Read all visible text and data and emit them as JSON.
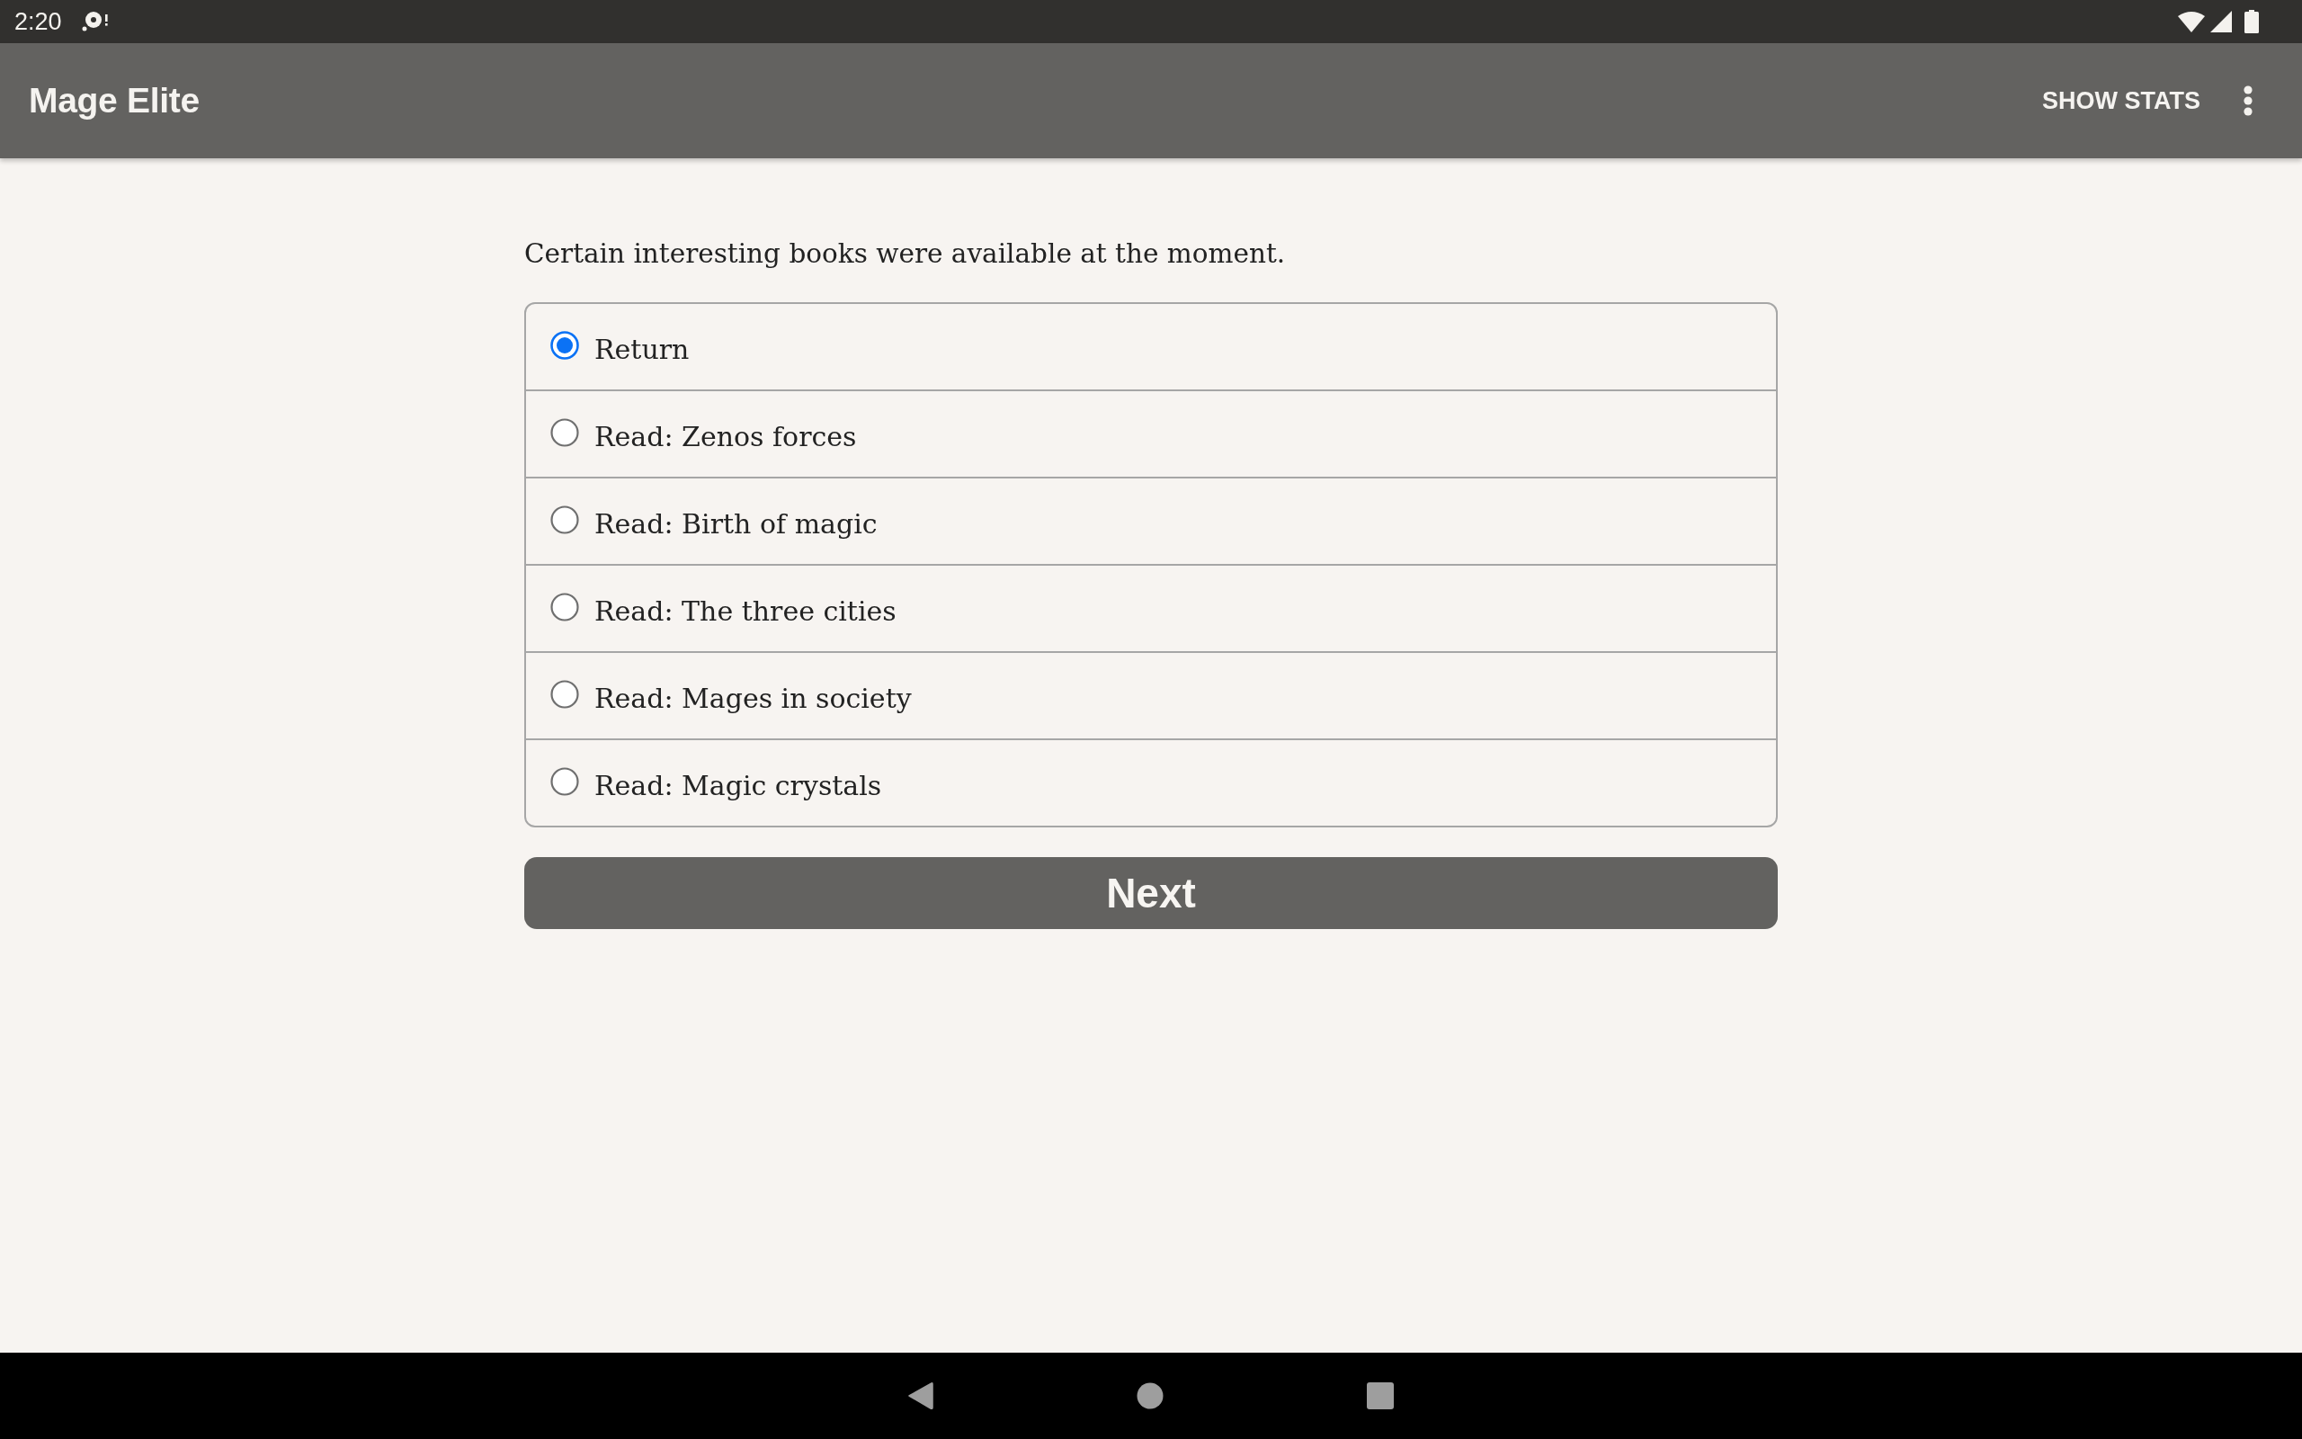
{
  "status_bar": {
    "time": "2:20"
  },
  "app_bar": {
    "title": "Mage Elite",
    "action": "SHOW STATS"
  },
  "prompt": "Certain interesting books were available at the moment.",
  "choices": [
    {
      "label": "Return",
      "selected": true
    },
    {
      "label": "Read: Zenos forces",
      "selected": false
    },
    {
      "label": "Read: Birth of magic",
      "selected": false
    },
    {
      "label": "Read: The three cities",
      "selected": false
    },
    {
      "label": "Read: Mages in society",
      "selected": false
    },
    {
      "label": "Read: Magic crystals",
      "selected": false
    }
  ],
  "next_button": "Next"
}
